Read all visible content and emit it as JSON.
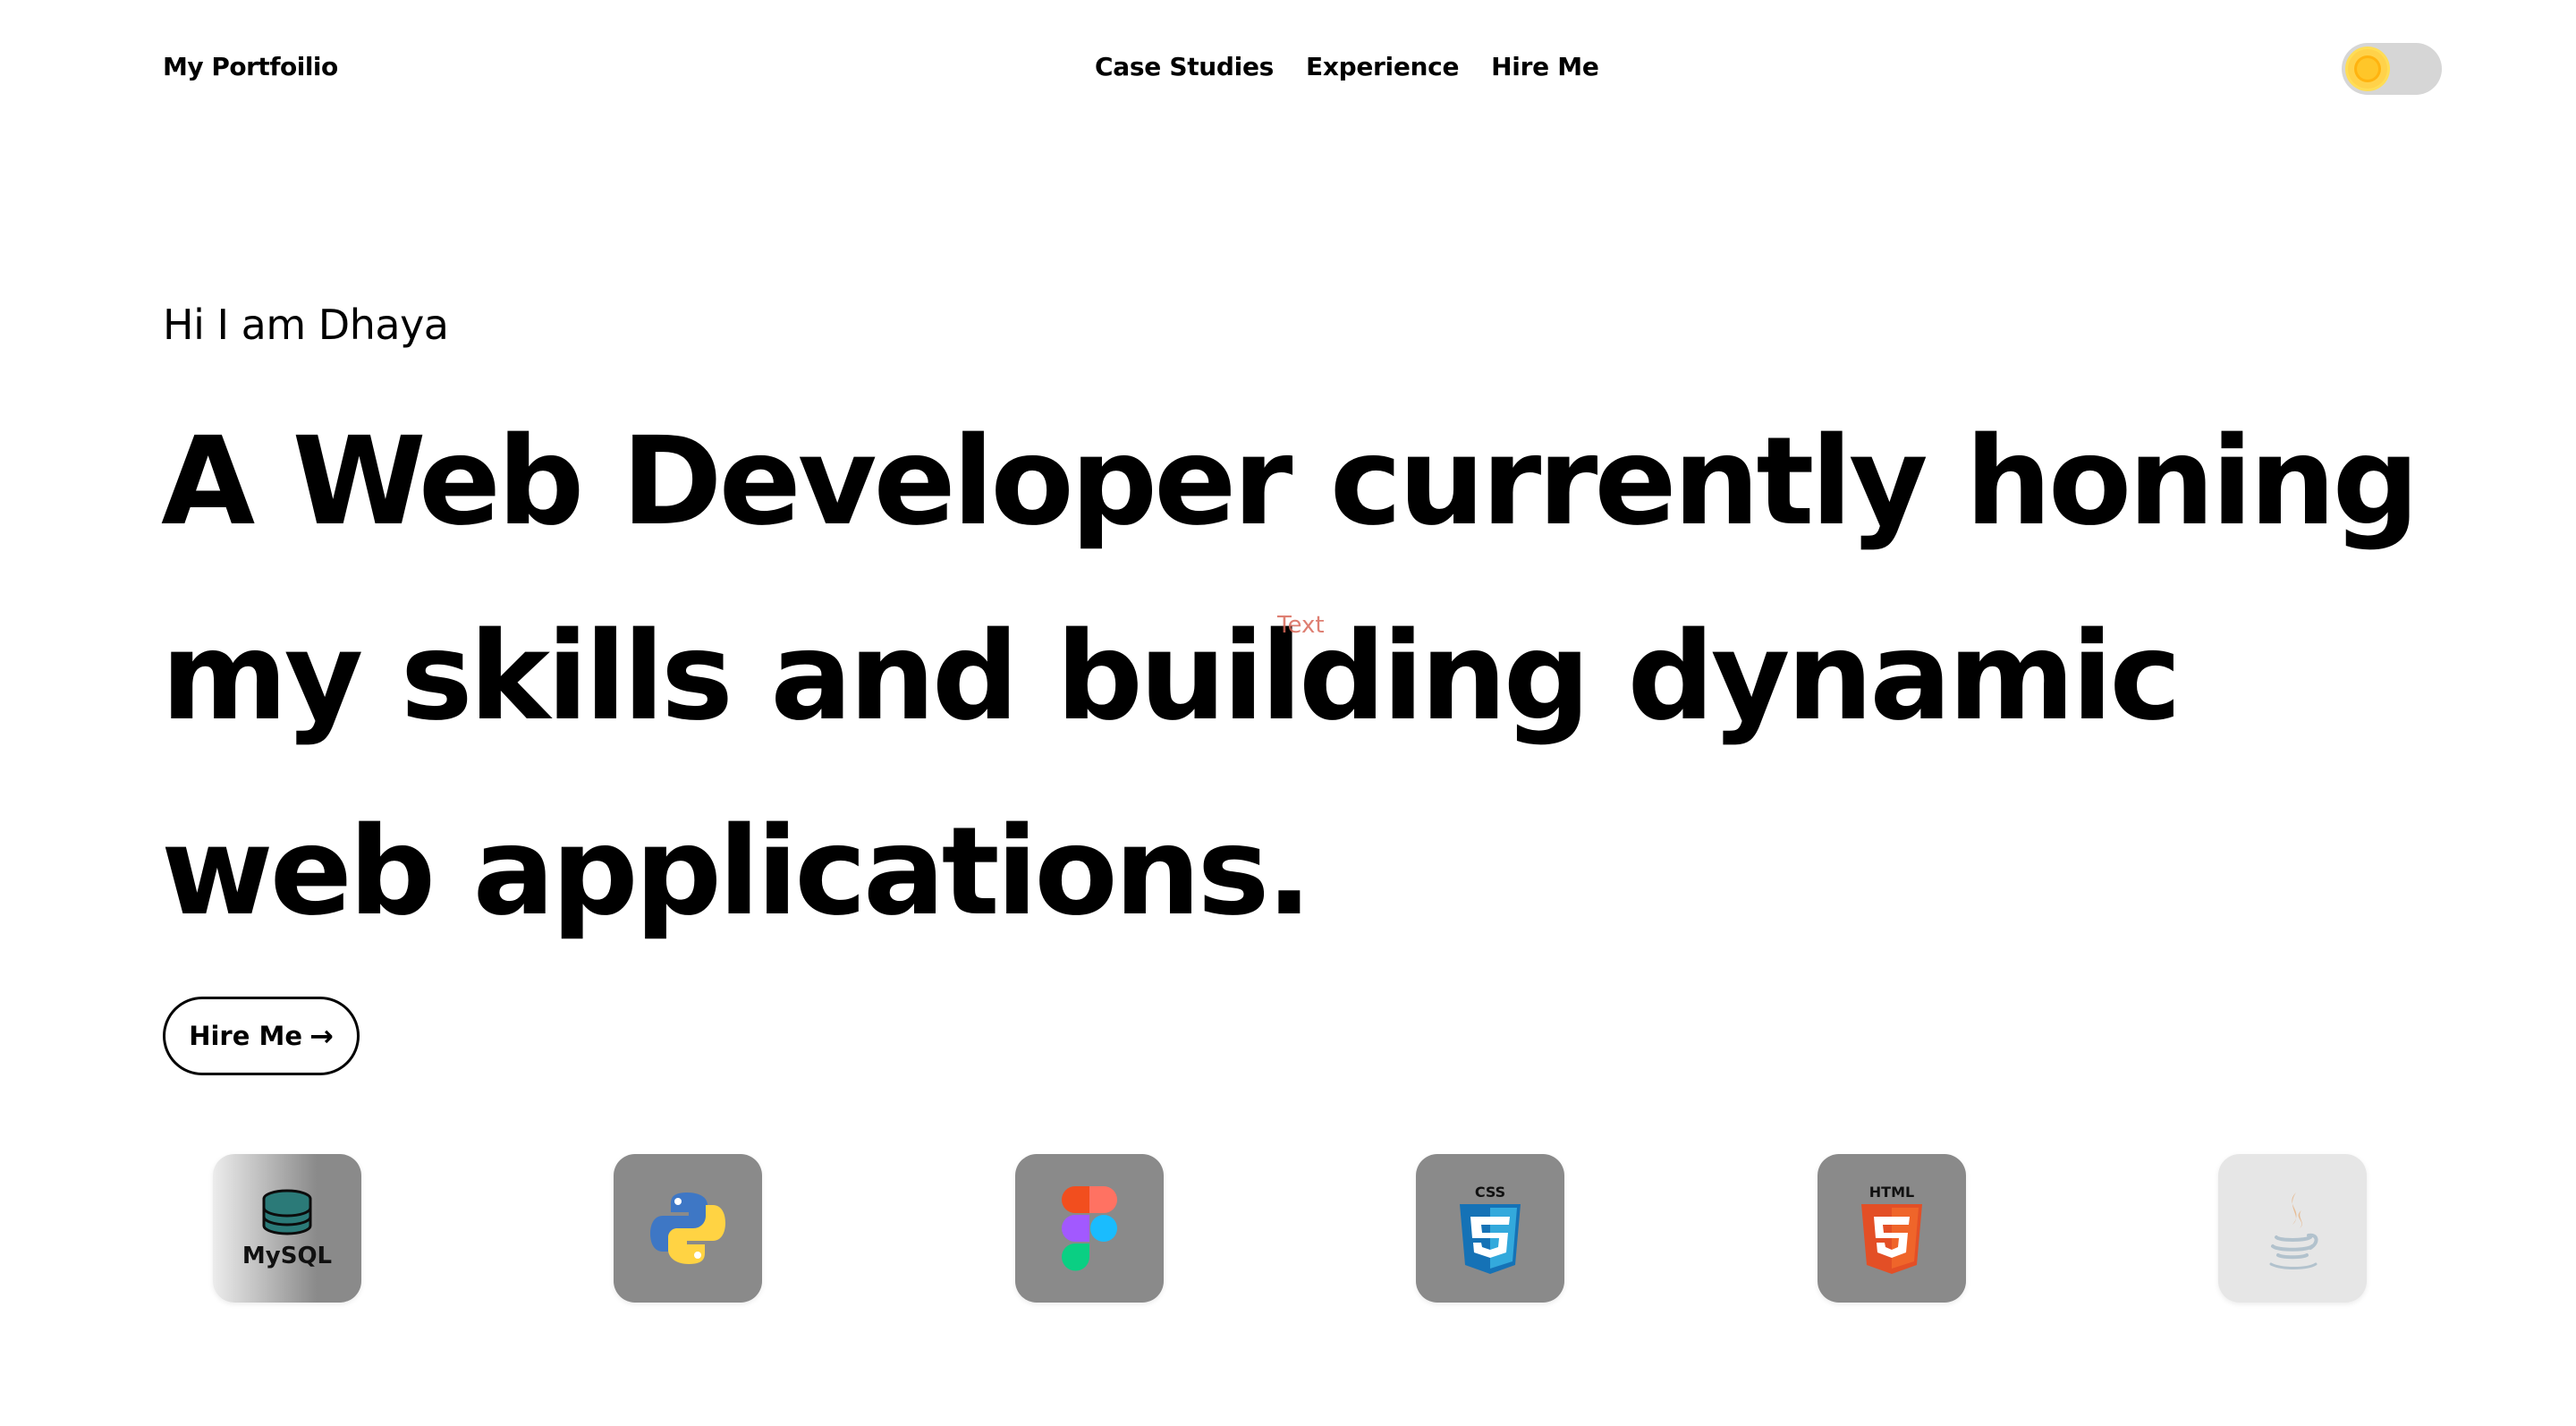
{
  "header": {
    "brand": "My Portfoilio",
    "nav": [
      "Case Studies",
      "Experience",
      "Hire Me"
    ]
  },
  "hero": {
    "greeting": "Hi I am Dhaya",
    "headline": "A Web Developer currently honing my skills and building dynamic web applications.",
    "stray_label": "Text",
    "cta": {
      "label": "Hire Me",
      "arrow": "→"
    }
  },
  "skills": [
    {
      "name": "mysql-icon",
      "label": "MySQL"
    },
    {
      "name": "python-icon"
    },
    {
      "name": "figma-icon"
    },
    {
      "name": "css3-icon",
      "label": "CSS"
    },
    {
      "name": "html5-icon",
      "label": "HTML"
    },
    {
      "name": "java-icon"
    }
  ],
  "colors": {
    "toggle_track": "#d6d6d6",
    "sun": "#ffcc33",
    "tile": "#8a8a8a"
  }
}
